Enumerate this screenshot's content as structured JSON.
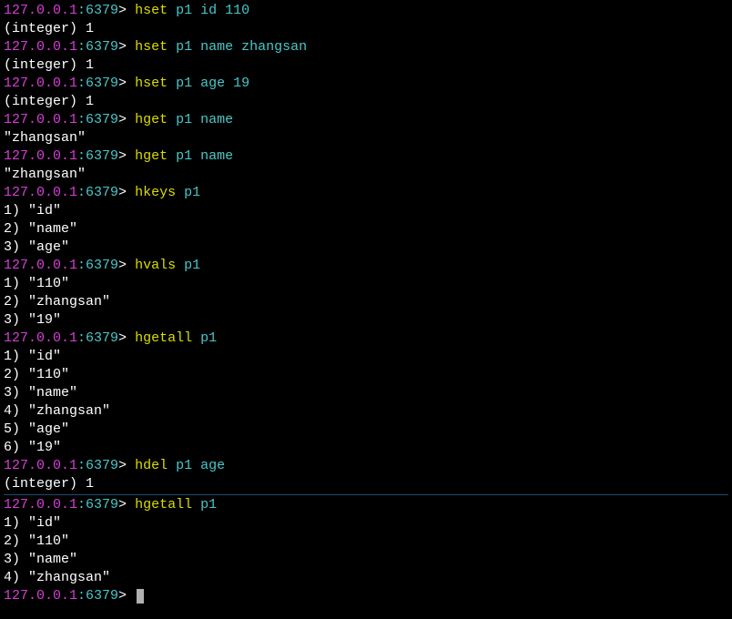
{
  "prompt": {
    "host": "127.0.0.1",
    "sep": ":",
    "port": "6379",
    "arrow": "> "
  },
  "blocks": [
    {
      "type": "cmdline",
      "cmd": "hset",
      "args": " p1 id 110"
    },
    {
      "type": "resp",
      "text": "(integer) 1"
    },
    {
      "type": "cmdline",
      "cmd": "hset",
      "args": " p1 name zhangsan"
    },
    {
      "type": "resp",
      "text": "(integer) 1"
    },
    {
      "type": "cmdline",
      "cmd": "hset",
      "args": " p1 age 19"
    },
    {
      "type": "resp",
      "text": "(integer) 1"
    },
    {
      "type": "cmdline",
      "cmd": "hget",
      "args": " p1 name"
    },
    {
      "type": "resp",
      "text": "\"zhangsan\""
    },
    {
      "type": "cmdline",
      "cmd": "hget",
      "args": " p1 name"
    },
    {
      "type": "resp",
      "text": "\"zhangsan\""
    },
    {
      "type": "cmdline",
      "cmd": "hkeys",
      "args": " p1"
    },
    {
      "type": "resp",
      "text": "1) \"id\""
    },
    {
      "type": "resp",
      "text": "2) \"name\""
    },
    {
      "type": "resp",
      "text": "3) \"age\""
    },
    {
      "type": "cmdline",
      "cmd": "hvals",
      "args": " p1"
    },
    {
      "type": "resp",
      "text": "1) \"110\""
    },
    {
      "type": "resp",
      "text": "2) \"zhangsan\""
    },
    {
      "type": "resp",
      "text": "3) \"19\""
    },
    {
      "type": "cmdline",
      "cmd": "hgetall",
      "args": " p1"
    },
    {
      "type": "resp",
      "text": "1) \"id\""
    },
    {
      "type": "resp",
      "text": "2) \"110\""
    },
    {
      "type": "resp",
      "text": "3) \"name\""
    },
    {
      "type": "resp",
      "text": "4) \"zhangsan\""
    },
    {
      "type": "resp",
      "text": "5) \"age\""
    },
    {
      "type": "resp",
      "text": "6) \"19\""
    },
    {
      "type": "cmdline",
      "cmd": "hdel",
      "args": " p1 age"
    },
    {
      "type": "resp",
      "text": "(integer) 1"
    },
    {
      "type": "divider"
    },
    {
      "type": "cmdline",
      "cmd": "hgetall",
      "args": " p1"
    },
    {
      "type": "resp",
      "text": "1) \"id\""
    },
    {
      "type": "resp",
      "text": "2) \"110\""
    },
    {
      "type": "resp",
      "text": "3) \"name\""
    },
    {
      "type": "resp",
      "text": "4) \"zhangsan\""
    },
    {
      "type": "promptonly"
    }
  ]
}
